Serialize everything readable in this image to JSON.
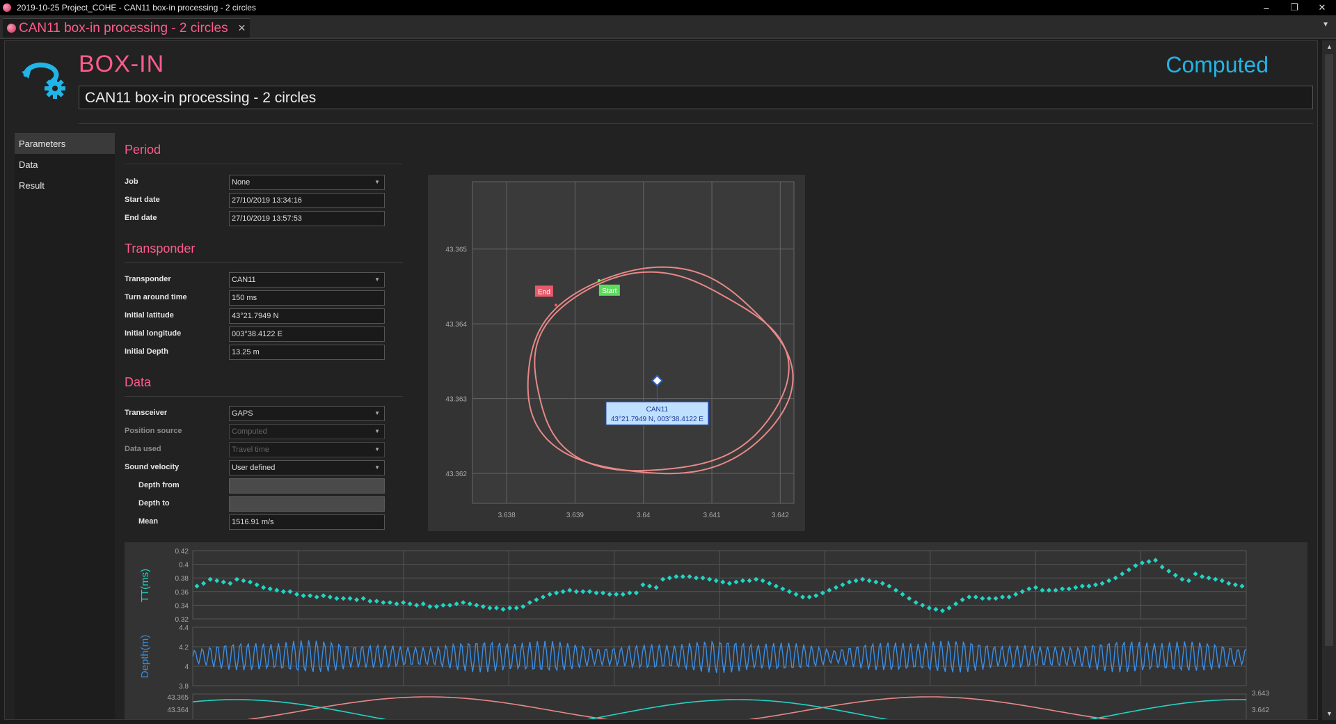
{
  "window": {
    "title": "2019-10-25 Project_COHE - CAN11 box-in processing - 2 circles",
    "minimize": "‒",
    "restore": "❐",
    "close": "✕"
  },
  "tab": {
    "label": "CAN11 box-in processing - 2 circles",
    "close": "✕",
    "menu": "▼"
  },
  "header": {
    "title": "BOX-IN",
    "status": "Computed",
    "name": "CAN11 box-in processing - 2 circles"
  },
  "nav": [
    "Parameters",
    "Data",
    "Result"
  ],
  "period": {
    "title": "Period",
    "job_label": "Job",
    "job_value": "None",
    "start_label": "Start date",
    "start_value": "27/10/2019 13:34:16",
    "end_label": "End date",
    "end_value": "27/10/2019 13:57:53"
  },
  "transponder": {
    "title": "Transponder",
    "transponder_label": "Transponder",
    "transponder_value": "CAN11",
    "tat_label": "Turn around time",
    "tat_value": "150 ms",
    "lat_label": "Initial latitude",
    "lat_value": "43°21.7949 N",
    "lon_label": "Initial longitude",
    "lon_value": "003°38.4122 E",
    "depth_label": "Initial Depth",
    "depth_value": "13.25 m"
  },
  "data": {
    "title": "Data",
    "transceiver_label": "Transceiver",
    "transceiver_value": "GAPS",
    "possrc_label": "Position source",
    "possrc_value": "Computed",
    "dataused_label": "Data used",
    "dataused_value": "Travel time",
    "sv_label": "Sound velocity",
    "sv_value": "User defined",
    "depthfrom_label": "Depth from",
    "depthfrom_value": "",
    "depthto_label": "Depth to",
    "depthto_value": "",
    "mean_label": "Mean",
    "mean_value": "1516.91 m/s"
  },
  "colors": {
    "accent": "#ff5c8d",
    "status": "#22b4e6",
    "track": "#e88888",
    "tt": "#22d4c4",
    "depth": "#3a8ee6"
  },
  "chart_data": [
    {
      "type": "scatter",
      "x_ticks": [
        "3.638",
        "3.639",
        "3.64",
        "3.641",
        "3.642"
      ],
      "y_ticks": [
        "43.365",
        "43.364",
        "43.363",
        "43.362"
      ],
      "xlim": [
        3.6375,
        3.6422
      ],
      "ylim": [
        43.3616,
        43.3659
      ],
      "start_label": "Start",
      "end_label": "End",
      "start_point": [
        3.63935,
        43.36458
      ],
      "end_point": [
        3.63872,
        43.36425
      ],
      "transponder": {
        "name": "CAN11",
        "position": "43°21.7949 N, 003°38.4122 E",
        "x": 3.6402,
        "y": 43.36324
      }
    },
    {
      "type": "scatter",
      "ylabel": "TT(ms)",
      "y_ticks": [
        "0.42",
        "0.4",
        "0.38",
        "0.36",
        "0.34",
        "0.32"
      ],
      "ylim": [
        0.32,
        0.42
      ],
      "values": [
        0.368,
        0.372,
        0.378,
        0.376,
        0.374,
        0.372,
        0.378,
        0.376,
        0.374,
        0.37,
        0.366,
        0.364,
        0.362,
        0.36,
        0.36,
        0.356,
        0.354,
        0.354,
        0.352,
        0.354,
        0.352,
        0.35,
        0.35,
        0.35,
        0.348,
        0.35,
        0.346,
        0.346,
        0.344,
        0.344,
        0.342,
        0.344,
        0.342,
        0.34,
        0.342,
        0.338,
        0.338,
        0.34,
        0.34,
        0.342,
        0.344,
        0.342,
        0.34,
        0.338,
        0.336,
        0.336,
        0.334,
        0.336,
        0.336,
        0.338,
        0.344,
        0.348,
        0.352,
        0.356,
        0.358,
        0.36,
        0.362,
        0.36,
        0.36,
        0.36,
        0.358,
        0.358,
        0.356,
        0.356,
        0.356,
        0.358,
        0.358,
        0.37,
        0.368,
        0.366,
        0.378,
        0.38,
        0.382,
        0.382,
        0.382,
        0.38,
        0.38,
        0.378,
        0.376,
        0.374,
        0.372,
        0.374,
        0.376,
        0.376,
        0.378,
        0.376,
        0.372,
        0.368,
        0.364,
        0.36,
        0.356,
        0.352,
        0.352,
        0.354,
        0.358,
        0.362,
        0.366,
        0.37,
        0.374,
        0.376,
        0.378,
        0.376,
        0.374,
        0.372,
        0.368,
        0.362,
        0.356,
        0.35,
        0.344,
        0.34,
        0.336,
        0.334,
        0.332,
        0.336,
        0.342,
        0.348,
        0.352,
        0.352,
        0.35,
        0.35,
        0.35,
        0.352,
        0.352,
        0.356,
        0.36,
        0.364,
        0.366,
        0.362,
        0.362,
        0.362,
        0.364,
        0.364,
        0.366,
        0.368,
        0.368,
        0.37,
        0.372,
        0.376,
        0.38,
        0.386,
        0.392,
        0.398,
        0.402,
        0.404,
        0.406,
        0.396,
        0.39,
        0.384,
        0.378,
        0.376,
        0.386,
        0.382,
        0.38,
        0.378,
        0.376,
        0.372,
        0.37,
        0.368
      ]
    },
    {
      "type": "line",
      "ylabel": "Depth(m)",
      "y_ticks": [
        "4.4",
        "4.2",
        "4",
        "3.8"
      ],
      "ylim": [
        3.8,
        4.4
      ],
      "center": 4.1
    },
    {
      "type": "line",
      "y_ticks": [
        "43.365",
        "43.364"
      ],
      "y2_ticks": [
        "3.643",
        "3.642"
      ]
    }
  ]
}
